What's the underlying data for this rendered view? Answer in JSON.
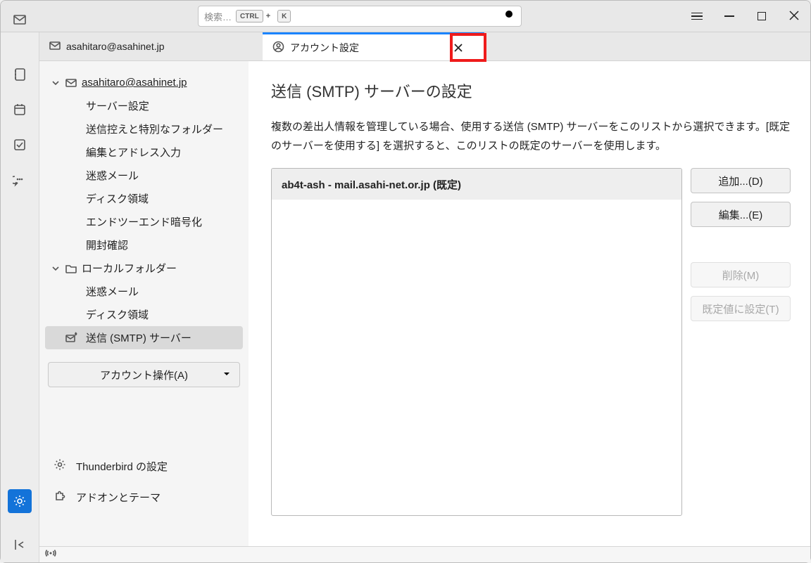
{
  "search": {
    "placeholder": "検索…",
    "kbd1": "CTRL",
    "kbd2": "K",
    "plus": "+"
  },
  "tabs": {
    "mail": {
      "label": "asahitaro@asahinet.jp"
    },
    "settings": {
      "label": "アカウント設定"
    }
  },
  "sidebar": {
    "account": {
      "label": "asahitaro@asahinet.jp"
    },
    "items": [
      "サーバー設定",
      "送信控えと特別なフォルダー",
      "編集とアドレス入力",
      "迷惑メール",
      "ディスク領域",
      "エンドツーエンド暗号化",
      "開封確認"
    ],
    "local": {
      "label": "ローカルフォルダー"
    },
    "localItems": [
      "迷惑メール",
      "ディスク領域"
    ],
    "smtp": "送信 (SMTP) サーバー",
    "accountActions": "アカウント操作(A)",
    "thunderbirdSettings": "Thunderbird の設定",
    "addons": "アドオンとテーマ"
  },
  "main": {
    "title": "送信 (SMTP) サーバーの設定",
    "description": "複数の差出人情報を管理している場合、使用する送信 (SMTP) サーバーをこのリストから選択できます。[既定のサーバーを使用する] を選択すると、このリストの既定のサーバーを使用します。",
    "listItem": "ab4t-ash - mail.asahi-net.or.jp (既定)",
    "buttons": {
      "add": "追加...(D)",
      "edit": "編集...(E)",
      "delete": "削除(M)",
      "setDefault": "既定値に設定(T)"
    }
  }
}
